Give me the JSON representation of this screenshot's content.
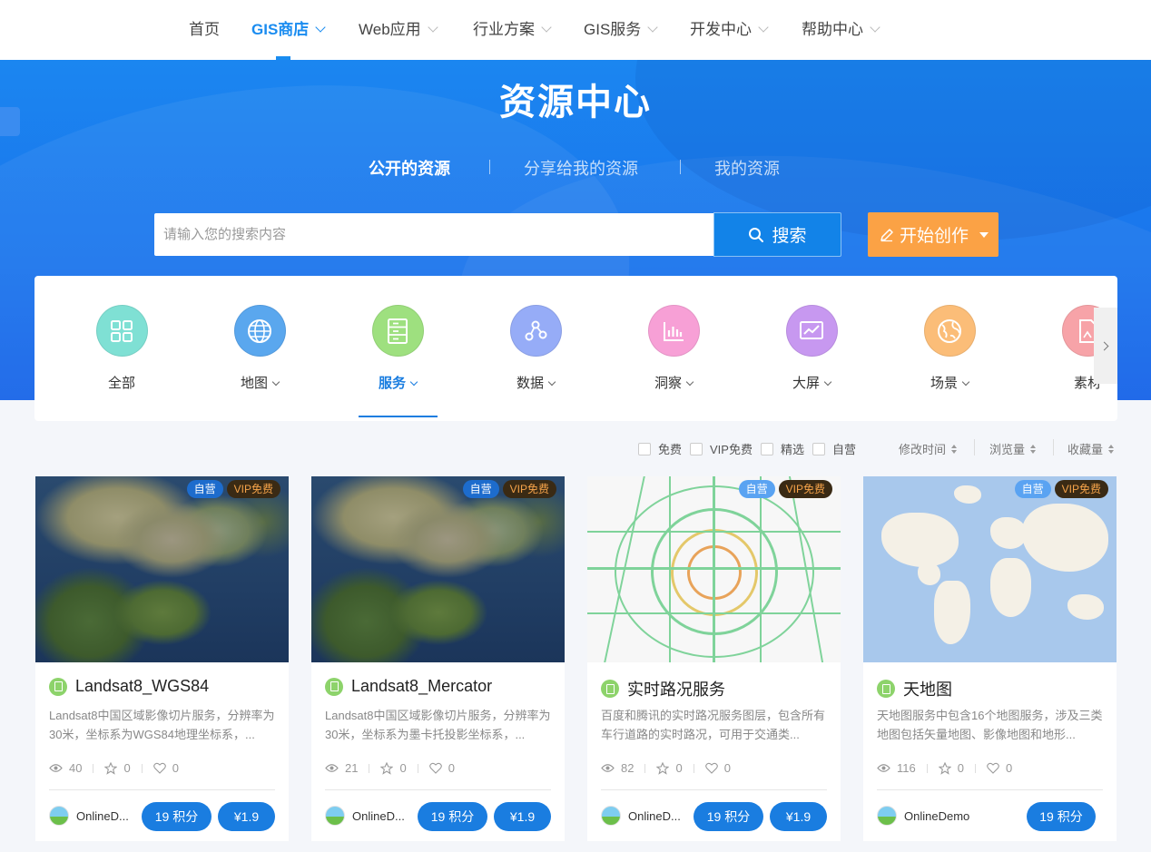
{
  "nav": {
    "items": [
      {
        "label": "首页",
        "dropdown": false,
        "active": false
      },
      {
        "label": "GIS商店",
        "dropdown": true,
        "active": true
      },
      {
        "label": "Web应用",
        "dropdown": true,
        "active": false
      },
      {
        "label": "行业方案",
        "dropdown": true,
        "active": false
      },
      {
        "label": "GIS服务",
        "dropdown": true,
        "active": false
      },
      {
        "label": "开发中心",
        "dropdown": true,
        "active": false
      },
      {
        "label": "帮助中心",
        "dropdown": true,
        "active": false
      }
    ]
  },
  "hero": {
    "title": "资源中心",
    "tabs": [
      {
        "label": "公开的资源",
        "active": true
      },
      {
        "label": "分享给我的资源",
        "active": false
      },
      {
        "label": "我的资源",
        "active": false
      }
    ],
    "search": {
      "placeholder": "请输入您的搜索内容",
      "value": "",
      "button_label": "搜索",
      "button_icon": "search-icon"
    },
    "create_button": {
      "label": "开始创作",
      "icon": "pencil-icon"
    }
  },
  "categories": [
    {
      "label": "全部",
      "icon": "grid-icon",
      "color": "#7fe0d4",
      "dropdown": false,
      "active": false
    },
    {
      "label": "地图",
      "icon": "globe-icon",
      "color": "#5aa7ee",
      "dropdown": true,
      "active": false
    },
    {
      "label": "服务",
      "icon": "server-icon",
      "color": "#9ee07f",
      "dropdown": true,
      "active": true
    },
    {
      "label": "数据",
      "icon": "nodes-icon",
      "color": "#96acf7",
      "dropdown": true,
      "active": false
    },
    {
      "label": "洞察",
      "icon": "bar-chart-icon",
      "color": "#f7a0d6",
      "dropdown": true,
      "active": false
    },
    {
      "label": "大屏",
      "icon": "line-chart-icon",
      "color": "#c798f0",
      "dropdown": true,
      "active": false
    },
    {
      "label": "场景",
      "icon": "earth-icon",
      "color": "#fbbd78",
      "dropdown": true,
      "active": false
    },
    {
      "label": "素材",
      "icon": "file-image-icon",
      "color": "#f7a3a8",
      "dropdown": false,
      "active": false
    }
  ],
  "filters": [
    {
      "label": "免费",
      "checked": false
    },
    {
      "label": "VIP免费",
      "checked": false
    },
    {
      "label": "精选",
      "checked": false
    },
    {
      "label": "自营",
      "checked": false
    }
  ],
  "sorts": [
    {
      "label": "修改时间"
    },
    {
      "label": "浏览量"
    },
    {
      "label": "收藏量"
    }
  ],
  "accent": "#1a7de0",
  "cards": [
    {
      "thumb": "satellite",
      "badges": [
        "自营",
        "VIP免费"
      ],
      "title": "Landsat8_WGS84",
      "desc": "Landsat8中国区域影像切片服务，分辨率为30米，坐标系为WGS84地理坐标系，...",
      "views": "40",
      "stars": "0",
      "likes": "0",
      "owner": "OnlineD...",
      "points": "19 积分",
      "price": "¥1.9"
    },
    {
      "thumb": "satellite",
      "badges": [
        "自营",
        "VIP免费"
      ],
      "title": "Landsat8_Mercator",
      "desc": "Landsat8中国区域影像切片服务，分辨率为30米，坐标系为墨卡托投影坐标系，...",
      "views": "21",
      "stars": "0",
      "likes": "0",
      "owner": "OnlineD...",
      "points": "19 积分",
      "price": "¥1.9"
    },
    {
      "thumb": "traffic",
      "badges": [
        "自营",
        "VIP免费"
      ],
      "title": "实时路况服务",
      "desc": "百度和腾讯的实时路况服务图层，包含所有车行道路的实时路况，可用于交通类...",
      "views": "82",
      "stars": "0",
      "likes": "0",
      "owner": "OnlineD...",
      "points": "19 积分",
      "price": "¥1.9"
    },
    {
      "thumb": "worldmap",
      "badges": [
        "自营",
        "VIP免费"
      ],
      "title": "天地图",
      "desc": "天地图服务中包含16个地图服务，涉及三类地图包括矢量地图、影像地图和地形...",
      "views": "116",
      "stars": "0",
      "likes": "0",
      "owner": "OnlineDemo",
      "points": "19 积分",
      "price": ""
    }
  ]
}
